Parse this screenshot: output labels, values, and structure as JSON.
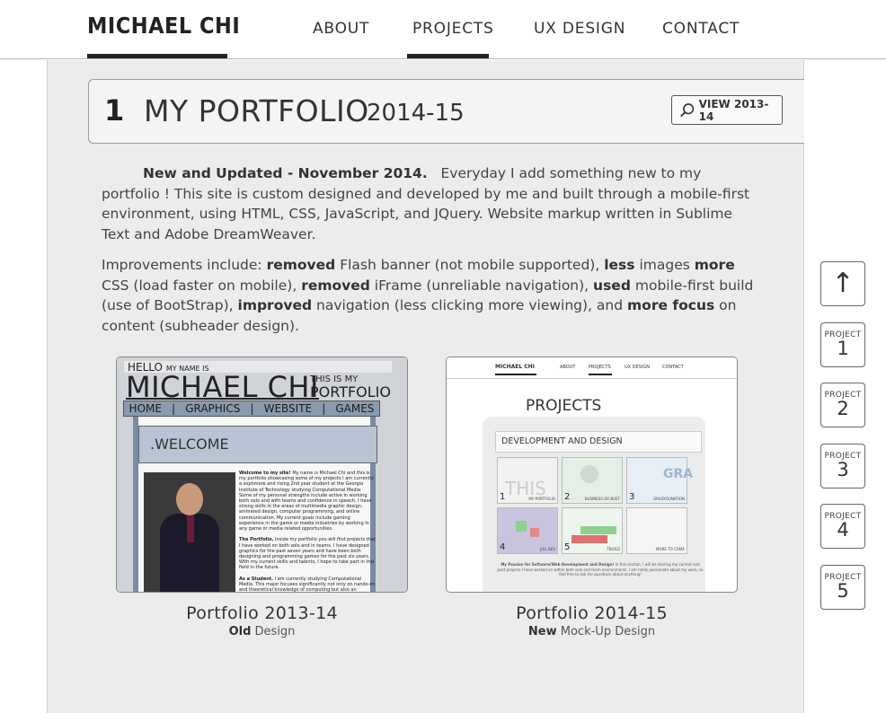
{
  "header": {
    "brand": "MICHAEL CHI",
    "nav": [
      {
        "label": "ABOUT"
      },
      {
        "label": "PROJECTS"
      },
      {
        "label": "UX DESIGN"
      },
      {
        "label": "CONTACT"
      }
    ],
    "active_nav": "PROJECTS"
  },
  "section": {
    "number": "1",
    "title": "MY PORTFOLIO",
    "year": "2014-15",
    "view_button": "VIEW 2013-14"
  },
  "intro": {
    "updated_label": "New and Updated - November 2014.",
    "updated_rest": "Everyday I add something new to my portfolio ! This site is custom designed and developed by me and built through a mobile-first environment, using HTML, CSS, JavaScript, and JQuery. Website markup written in Sublime Text and Adobe DreamWeaver."
  },
  "improvements": {
    "lead": "Improvements include:",
    "items": [
      {
        "bold": "removed",
        "text": "Flash banner (not mobile supported),"
      },
      {
        "bold": "less",
        "text": "images"
      },
      {
        "bold": "more",
        "text": "CSS (load faster on mobile),"
      },
      {
        "bold": "removed",
        "text": "iFrame (unreliable navigation),"
      },
      {
        "bold": "used",
        "text": "mobile-first build (use of BootStrap),"
      },
      {
        "bold": "improved",
        "text": "navigation (less clicking more viewing), and"
      },
      {
        "bold": "more focus",
        "text": "on content (subheader design)."
      }
    ]
  },
  "portfolios": [
    {
      "title": "Portfolio 2013-14",
      "sub_bold": "Old",
      "sub_rest": "Design"
    },
    {
      "title": "Portfolio 2014-15",
      "sub_bold": "New",
      "sub_rest": "Mock-Up Design"
    }
  ],
  "old_thumb": {
    "hello": "HELLO",
    "my_name_is": "MY NAME IS",
    "name": "MICHAEL CHI",
    "this_is_my": "THIS IS MY",
    "portfolio": "PORTFOLIO",
    "nav": [
      "HOME",
      "GRAPHICS",
      "WEBSITE",
      "GAMES"
    ],
    "welcome": ".WELCOME",
    "text_p1_bold": "Welcome to my site!",
    "text_p1": "My name is Michael Chi and this is my portfolio showcasing some of my projects I am currently a sophmore and rising 2nd year student at the Georgia Institute of Technology studying Computational Media. Some of my personal strengths include active in working both solo and with teams and confidence in speech. I have strong skills in the areas of multimedia graphic design, animated design, computer programming, and online communication. My current goals include gaming experience in the game or media industries by working in any game or media related opportunities.",
    "text_p2_bold": "The Portfolio.",
    "text_p2": "Inside my portfolio you will find projects that I have worked on both solo and in teams. I have designed graphics for the past seven years and have been both designing and programming games for the past six years. With my current skills and talents, I hope to take part in this field in the future.",
    "text_p3_bold": "As a Student.",
    "text_p3": "I am currently studying Computational Media. This major focuses significantly not only on hands-on and theoretical knowledge of computing but also an understanding of visual design and the history of media. I am very eager"
  },
  "new_thumb": {
    "brand": "MICHAEL CHI",
    "nav": [
      "ABOUT",
      "PROJECTS",
      "UX DESIGN",
      "CONTACT"
    ],
    "heading": "PROJECTS",
    "sub": "DEVELOPMENT AND DESIGN",
    "tiles": [
      {
        "num": "1",
        "label": "MY PORTFOLIO"
      },
      {
        "num": "2",
        "label": "BUSINESS OR BUST"
      },
      {
        "num": "3",
        "label": "GRADYOUNATION"
      },
      {
        "num": "4",
        "label": "JUG DEV"
      },
      {
        "num": "5",
        "label": "TBUILD"
      },
      {
        "num": "",
        "label": "MORE TO COME"
      }
    ],
    "footer_bold": "My Passion for Software/Web Development and Design!",
    "footer": "In this section, I will be sharing my current and past projects I have worked on within both solo and team environments. I am really passionate about my work, so feel free to ask me questions about anything!"
  },
  "side_nav": {
    "up_glyph": "↑",
    "label": "PROJECT",
    "numbers": [
      "1",
      "2",
      "3",
      "4",
      "5"
    ]
  }
}
